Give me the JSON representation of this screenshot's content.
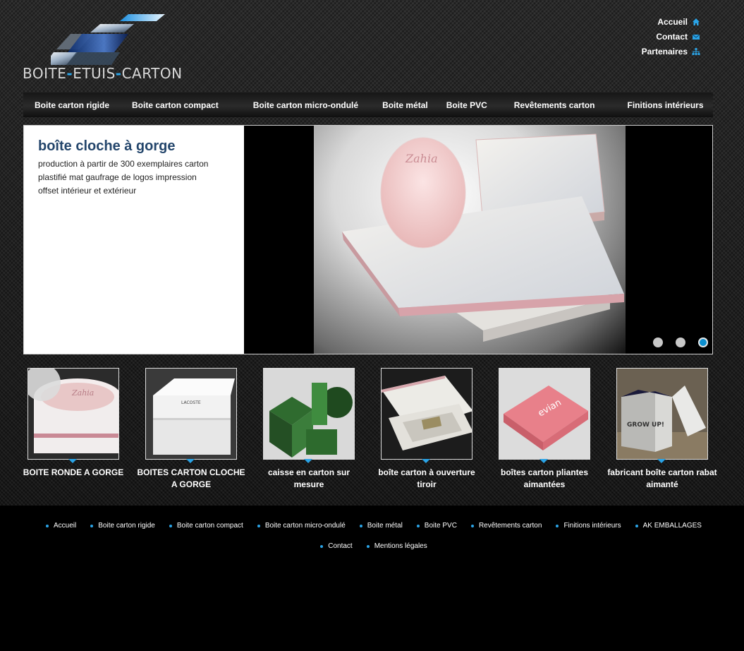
{
  "brand": {
    "logo_parts": [
      "BOITE",
      "ETUIS",
      "CARTON"
    ],
    "accent_color": "#2aa3e6"
  },
  "top_links": [
    {
      "label": "Accueil",
      "icon": "home-icon"
    },
    {
      "label": "Contact",
      "icon": "mail-icon"
    },
    {
      "label": "Partenaires",
      "icon": "sitemap-icon"
    }
  ],
  "nav": [
    "Boite carton rigide",
    "Boite carton compact",
    "Boite carton micro-ondulé",
    "Boite métal",
    "Boite PVC",
    "Revêtements carton",
    "Finitions intérieurs"
  ],
  "slider": {
    "title": "boîte cloche à gorge",
    "description": "production à partir de 300 exemplaires carton plastifié mat gaufrage de logos impression offset intérieur et extérieur",
    "image_brand": "Zahia",
    "dots": 3,
    "active_dot": 3
  },
  "thumbnails": [
    {
      "label": "BOITE RONDE A GORGE",
      "brand": "Zahia"
    },
    {
      "label": "BOITES CARTON CLOCHE A GORGE",
      "brand": "LACOSTE"
    },
    {
      "label": "caisse en carton sur mesure",
      "brand": ""
    },
    {
      "label": "boîte carton à ouverture tiroir",
      "brand": ""
    },
    {
      "label": "boîtes carton pliantes aimantées",
      "brand": "evian"
    },
    {
      "label": "fabricant boîte carton rabat aimanté",
      "brand": "GROW UP!"
    }
  ],
  "footer_links": [
    "Accueil",
    "Boite carton rigide",
    "Boite carton compact",
    "Boite carton micro-ondulé",
    "Boite métal",
    "Boite PVC",
    "Revêtements carton",
    "Finitions intérieurs",
    "AK EMBALLAGES",
    "Contact",
    "Mentions légales"
  ]
}
